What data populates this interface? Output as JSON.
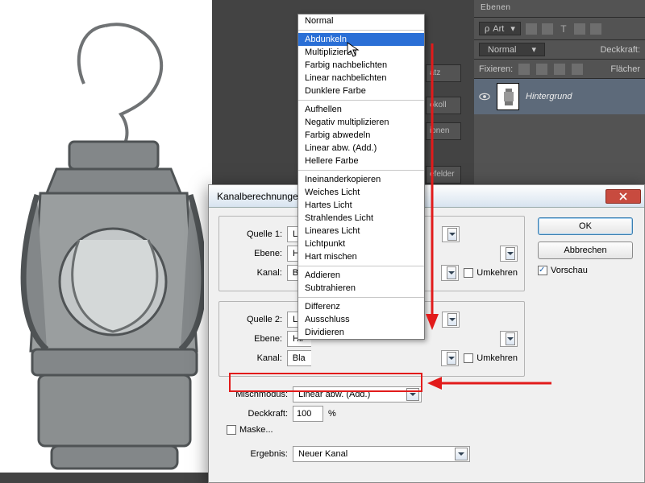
{
  "right_panel": {
    "header": "Ebenen",
    "art": "Art",
    "mode_sel": "Normal",
    "opacity_label": "Deckkraft:",
    "lock_label": "Fixieren:",
    "fill_label": "Flächer",
    "layer_name": "Hintergrund"
  },
  "side_tabs": [
    "atz",
    "okoll",
    "ionen",
    "efelder"
  ],
  "dialog": {
    "title": "Kanalberechnungen",
    "labels": {
      "quelle1": "Quelle 1:",
      "quelle2": "Quelle 2:",
      "ebene": "Ebene:",
      "kanal": "Kanal:",
      "misch": "Mischmodus:",
      "deck": "Deckkraft:",
      "maske": "Maske...",
      "ergebnis": "Ergebnis:",
      "umkehren": "Umkehren",
      "vorschau": "Vorschau",
      "ok": "OK",
      "abbrechen": "Abbrechen",
      "percent": "%"
    },
    "values": {
      "quelle_trunc": "L",
      "ebene_trunc": "Hir",
      "kanal_trunc": "Bla",
      "mischmodus": "Linear abw. (Add.)",
      "deckkraft": "100",
      "ergebnis": "Neuer Kanal",
      "vorschau_checked": true
    }
  },
  "dropdown": {
    "groups": [
      [
        "Normal"
      ],
      [
        "Abdunkeln",
        "Multiplizieren",
        "Farbig nachbelichten",
        "Linear nachbelichten",
        "Dunklere Farbe"
      ],
      [
        "Aufhellen",
        "Negativ multiplizieren",
        "Farbig abwedeln",
        "Linear abw. (Add.)",
        "Hellere Farbe"
      ],
      [
        "Ineinanderkopieren",
        "Weiches Licht",
        "Hartes Licht",
        "Strahlendes Licht",
        "Lineares Licht",
        "Lichtpunkt",
        "Hart mischen"
      ],
      [
        "Addieren",
        "Subtrahieren"
      ],
      [
        "Differenz",
        "Ausschluss",
        "Dividieren"
      ]
    ],
    "hover_index": [
      1,
      0
    ]
  }
}
